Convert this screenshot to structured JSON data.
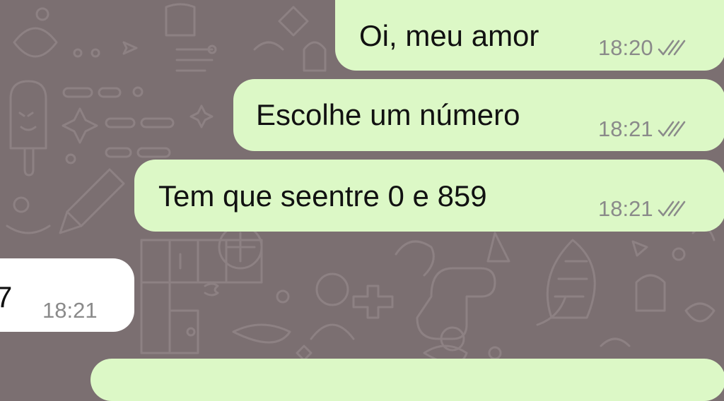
{
  "chat": {
    "messages": [
      {
        "direction": "outgoing",
        "text": "Oi, meu amor",
        "time": "18:20",
        "status_icon": "double-check-icon"
      },
      {
        "direction": "outgoing",
        "text": "Escolhe um número",
        "time": "18:21",
        "status_icon": "double-check-icon"
      },
      {
        "direction": "outgoing",
        "text": "Tem que seentre 0 e 859",
        "time": "18:21",
        "status_icon": "double-check-icon"
      },
      {
        "direction": "incoming",
        "text": "7",
        "time": "18:21"
      }
    ]
  },
  "colors": {
    "wallpaper": "#7b6f71",
    "outgoing_bubble": "#dcf8c6",
    "incoming_bubble": "#ffffff",
    "time_text": "#8a8a8a"
  }
}
